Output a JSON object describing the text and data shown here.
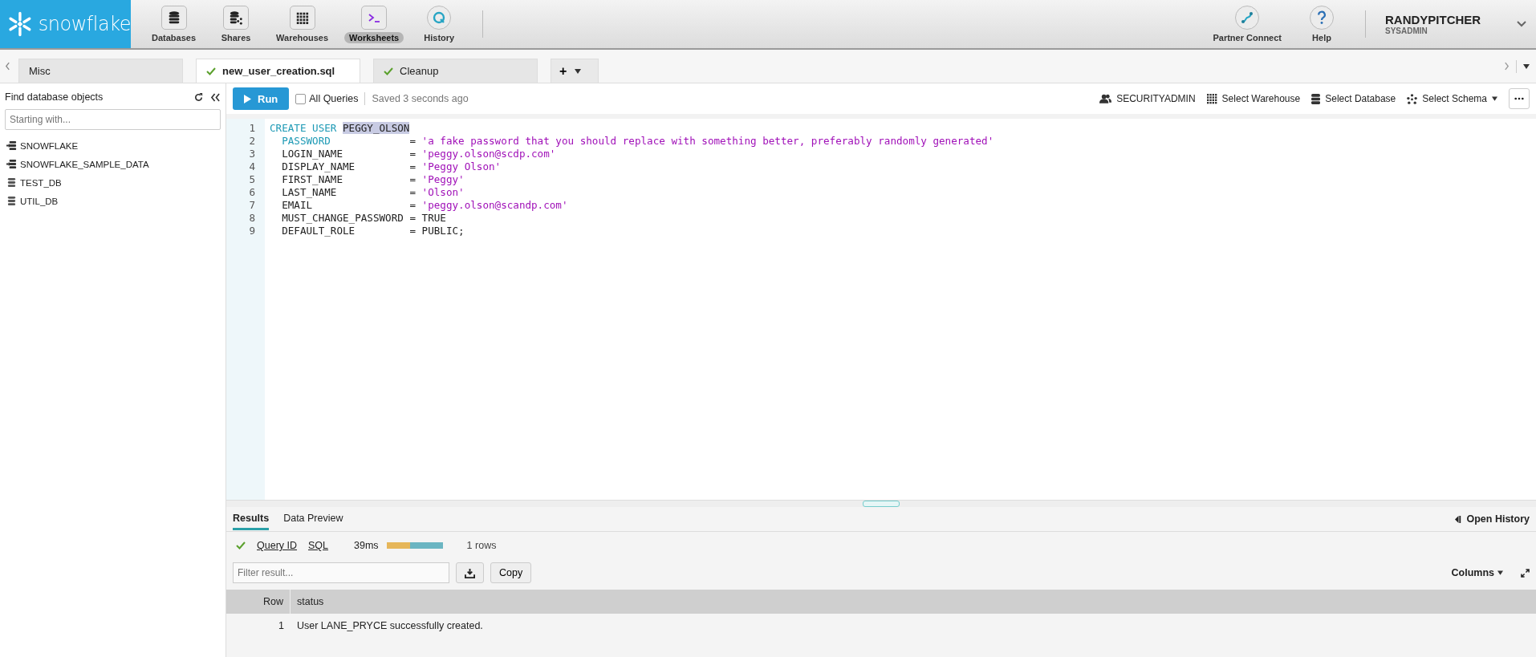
{
  "header": {
    "logo": "snowflake",
    "nav": [
      {
        "label": "Databases",
        "kind": "database",
        "selected": false
      },
      {
        "label": "Shares",
        "kind": "share",
        "selected": false
      },
      {
        "label": "Warehouses",
        "kind": "grid",
        "selected": false
      },
      {
        "label": "Worksheets",
        "kind": "terminal",
        "selected": true
      },
      {
        "label": "History",
        "kind": "history",
        "selected": false
      }
    ],
    "right": [
      {
        "label": "Partner Connect",
        "kind": "connect"
      },
      {
        "label": "Help",
        "kind": "help"
      }
    ],
    "user": {
      "name": "RANDYPITCHER",
      "role": "SYSADMIN"
    }
  },
  "worksheet_tabs": [
    {
      "label": "Misc",
      "saved": false,
      "selected": false
    },
    {
      "label": "new_user_creation.sql",
      "saved": true,
      "selected": true
    },
    {
      "label": "Cleanup",
      "saved": true,
      "selected": false
    }
  ],
  "new_tab": "+",
  "sidebar": {
    "title": "Find database objects",
    "search": {
      "placeholder": "Starting with..."
    },
    "items": [
      {
        "label": "SNOWFLAKE",
        "shared": true
      },
      {
        "label": "SNOWFLAKE_SAMPLE_DATA",
        "shared": true
      },
      {
        "label": "TEST_DB",
        "shared": false
      },
      {
        "label": "UTIL_DB",
        "shared": false
      }
    ]
  },
  "toolbar": {
    "run": "Run",
    "all_queries": {
      "label": "All Queries",
      "checked": false
    },
    "saved": "Saved 3 seconds ago",
    "context": [
      {
        "label": "SECURITYADMIN",
        "kind": "users"
      },
      {
        "label": "Select Warehouse",
        "kind": "grid"
      },
      {
        "label": "Select Database",
        "kind": "database"
      },
      {
        "label": "Select Schema",
        "kind": "schema"
      }
    ]
  },
  "code": [
    {
      "number": "1",
      "segments": [
        {
          "text": "CREATE USER ",
          "kind": "keyword"
        },
        {
          "text": "PEGGY_OLSON",
          "kind": "selected"
        }
      ]
    },
    {
      "number": "2",
      "segments": [
        {
          "text": "  PASSWORD",
          "kind": "keyword"
        },
        {
          "text": "             = ",
          "kind": "plain"
        },
        {
          "text": "'a fake password that you should replace with something better, preferably randomly generated'",
          "kind": "string"
        }
      ]
    },
    {
      "number": "3",
      "segments": [
        {
          "text": "  LOGIN_NAME           = ",
          "kind": "plain"
        },
        {
          "text": "'peggy.olson@scdp.com'",
          "kind": "string"
        }
      ]
    },
    {
      "number": "4",
      "segments": [
        {
          "text": "  DISPLAY_NAME         = ",
          "kind": "plain"
        },
        {
          "text": "'Peggy Olson'",
          "kind": "string"
        }
      ]
    },
    {
      "number": "5",
      "segments": [
        {
          "text": "  FIRST_NAME           = ",
          "kind": "plain"
        },
        {
          "text": "'Peggy'",
          "kind": "string"
        }
      ]
    },
    {
      "number": "6",
      "segments": [
        {
          "text": "  LAST_NAME            = ",
          "kind": "plain"
        },
        {
          "text": "'Olson'",
          "kind": "string"
        }
      ]
    },
    {
      "number": "7",
      "segments": [
        {
          "text": "  EMAIL                = ",
          "kind": "plain"
        },
        {
          "text": "'peggy.olson@scandp.com'",
          "kind": "string"
        }
      ]
    },
    {
      "number": "8",
      "segments": [
        {
          "text": "  MUST_CHANGE_PASSWORD = TRUE",
          "kind": "plain"
        }
      ]
    },
    {
      "number": "9",
      "segments": [
        {
          "text": "  DEFAULT_ROLE         = PUBLIC;",
          "kind": "plain"
        }
      ]
    }
  ],
  "results": {
    "tabs": [
      {
        "label": "Results",
        "selected": true
      },
      {
        "label": "Data Preview",
        "selected": false
      }
    ],
    "open_history": "Open History",
    "query_id": "Query ID",
    "sql": "SQL",
    "duration": "39ms",
    "timing": {
      "level": 0.42
    },
    "rows": "1 rows",
    "filter": {
      "placeholder": "Filter result..."
    },
    "copy": "Copy",
    "columns": "Columns",
    "table": {
      "columns": [
        "Row",
        "status"
      ],
      "rows": [
        [
          "1",
          "User LANE_PRYCE successfully created."
        ]
      ]
    }
  }
}
